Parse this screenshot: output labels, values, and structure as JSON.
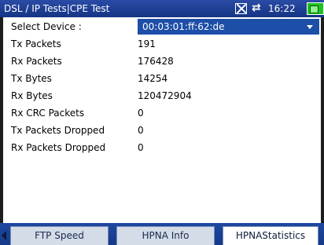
{
  "titlebar": {
    "title": "DSL / IP Tests|CPE Test",
    "time": "16:22",
    "icons": [
      "signal-off-icon",
      "sync-icon",
      "battery-icon"
    ]
  },
  "device": {
    "label": "Select Device :",
    "value": "00:03:01:ff:62:de"
  },
  "stats": [
    {
      "label": "Tx Packets",
      "value": "191"
    },
    {
      "label": "Rx Packets",
      "value": "176428"
    },
    {
      "label": "Tx Bytes",
      "value": "14254"
    },
    {
      "label": "Rx Bytes",
      "value": "120472904"
    },
    {
      "label": "Rx CRC Packets",
      "value": "0"
    },
    {
      "label": "Tx Packets Dropped",
      "value": "0"
    },
    {
      "label": "Rx Packets Dropped",
      "value": "0"
    }
  ],
  "tabs": [
    {
      "label": "FTP Speed",
      "active": false
    },
    {
      "label": "HPNA Info",
      "active": false
    },
    {
      "label": "HPNAStatistics",
      "active": true
    }
  ],
  "colors": {
    "titlebar": "#1d3f96",
    "selection": "#1d4ea8",
    "tab_active": "#ffffff",
    "tab_inactive": "#d4dce8"
  }
}
